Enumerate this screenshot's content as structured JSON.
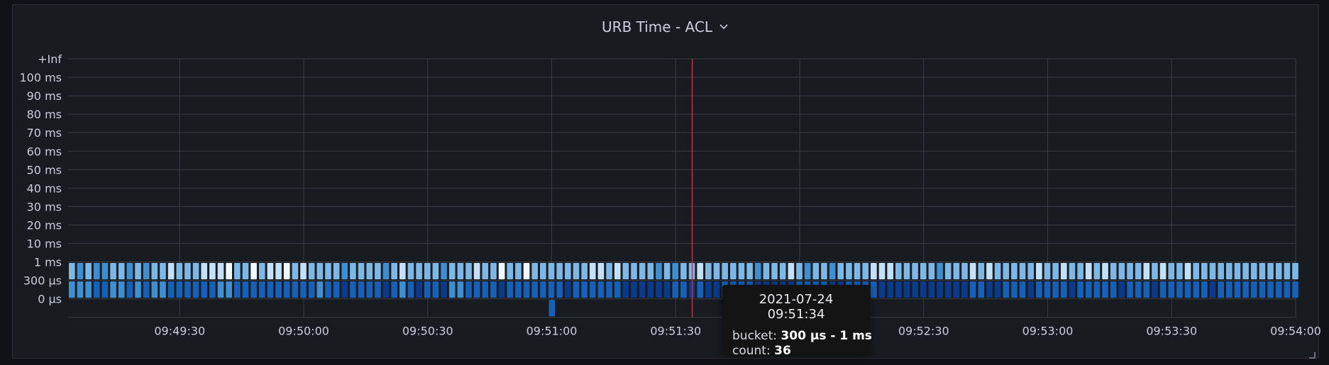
{
  "panel": {
    "title": "URB Time - ACL",
    "menu_icon": "chevron-down-icon",
    "resize_icon": "resize-handle-icon"
  },
  "tooltip": {
    "time": "2021-07-24 09:51:34",
    "bucket_label": "bucket:",
    "bucket_value": "300 µs - 1 ms",
    "count_label": "count:",
    "count_value": "36"
  },
  "colors": {
    "background": "#181b1f",
    "grid": "#3a3d44",
    "cursor": "#c4314b",
    "scale": [
      "#0b3a8a",
      "#1660b8",
      "#3f8fd0",
      "#7db7e6",
      "#c4e0f7",
      "#f2f7fc"
    ]
  },
  "chart_data": {
    "type": "heatmap",
    "title": "URB Time - ACL",
    "y_buckets": [
      "0 µs",
      "300 µs",
      "1 ms",
      "10 ms",
      "20 ms",
      "30 ms",
      "40 ms",
      "50 ms",
      "60 ms",
      "70 ms",
      "80 ms",
      "90 ms",
      "100 ms",
      "+Inf"
    ],
    "x_ticks": [
      "09:49:30",
      "09:50:00",
      "09:50:30",
      "09:51:00",
      "09:51:30",
      "09:52:00",
      "09:52:30",
      "09:53:00",
      "09:53:30",
      "09:54:00"
    ],
    "x_range": [
      "09:49:03",
      "09:54:00"
    ],
    "interval_seconds": 2,
    "hover_time": "09:51:34",
    "rows": [
      {
        "bucket": "300 µs - 1 ms",
        "levels": [
          3,
          2,
          3,
          2,
          2,
          3,
          3,
          2,
          3,
          2,
          3,
          3,
          4,
          3,
          3,
          3,
          4,
          4,
          4,
          5,
          3,
          3,
          5,
          3,
          4,
          4,
          5,
          3,
          4,
          3,
          3,
          3,
          3,
          2,
          3,
          3,
          3,
          3,
          2,
          3,
          4,
          3,
          3,
          3,
          3,
          2,
          3,
          3,
          3,
          4,
          3,
          3,
          5,
          3,
          3,
          5,
          3,
          3,
          3,
          3,
          3,
          3,
          3,
          4,
          4,
          3,
          4,
          3,
          3,
          3,
          3,
          2,
          3,
          2,
          3,
          3,
          4,
          3,
          3,
          3,
          3,
          3,
          3,
          2,
          3,
          3,
          3,
          4,
          3,
          2,
          3,
          3,
          2,
          3,
          3,
          3,
          3,
          4,
          4,
          4,
          3,
          3,
          3,
          3,
          3,
          2,
          3,
          3,
          3,
          4,
          3,
          4,
          3,
          3,
          3,
          3,
          3,
          4,
          3,
          3,
          4,
          3,
          3,
          4,
          3,
          4,
          3,
          3,
          3,
          3,
          4,
          3,
          4,
          3,
          3,
          4,
          3,
          3,
          3,
          3,
          3,
          3,
          3,
          3,
          3,
          3,
          3,
          3,
          3,
          3
        ]
      },
      {
        "bucket": "0 µs - 300 µs",
        "levels": [
          2,
          2,
          2,
          1,
          1,
          2,
          2,
          1,
          2,
          1,
          2,
          2,
          1,
          1,
          1,
          1,
          1,
          1,
          2,
          2,
          1,
          1,
          1,
          1,
          1,
          1,
          1,
          1,
          1,
          1,
          2,
          1,
          1,
          0,
          1,
          1,
          1,
          1,
          0,
          1,
          2,
          1,
          0,
          1,
          1,
          0,
          2,
          2,
          1,
          1,
          1,
          1,
          0,
          1,
          1,
          1,
          1,
          1,
          1,
          1,
          0,
          1,
          1,
          1,
          1,
          1,
          1,
          0,
          0,
          0,
          0,
          0,
          0,
          1,
          1,
          0,
          1,
          0,
          0,
          1,
          1,
          1,
          1,
          0,
          0,
          0,
          0,
          0,
          1,
          1,
          1,
          1,
          0,
          0,
          1,
          1,
          1,
          1,
          0,
          0,
          0,
          0,
          0,
          0,
          0,
          0,
          0,
          0,
          0,
          1,
          1,
          0,
          0,
          1,
          1,
          1,
          0,
          1,
          1,
          1,
          1,
          0,
          1,
          1,
          1,
          1,
          1,
          0,
          1,
          1,
          1,
          0,
          1,
          1,
          1,
          1,
          1,
          1,
          0,
          1,
          1,
          1,
          1,
          1,
          1,
          1,
          1,
          1,
          1,
          1
        ]
      },
      {
        "bucket": "below 0 µs",
        "levels": [],
        "single_cell_time": "09:51:00"
      }
    ]
  }
}
